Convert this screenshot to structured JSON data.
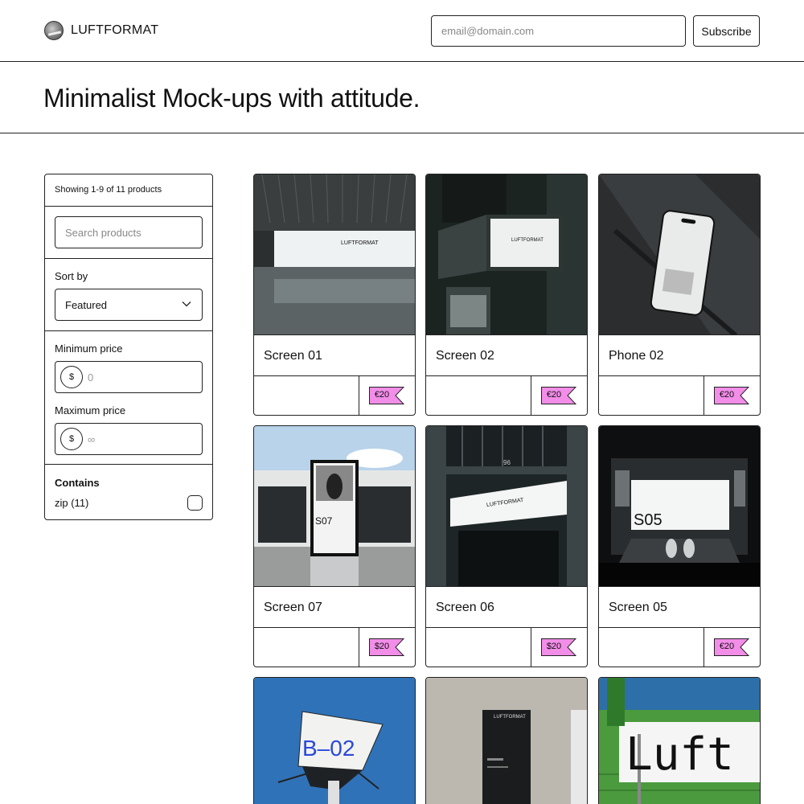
{
  "brand": {
    "name": "LUFTFORMAT"
  },
  "newsletter": {
    "email_placeholder": "email@domain.com",
    "subscribe_label": "Subscribe"
  },
  "hero": {
    "title": "Minimalist Mock-ups with attitude."
  },
  "sidebar": {
    "count_text": "Showing 1-9 of 11 products",
    "search_placeholder": "Search products",
    "sort_label": "Sort by",
    "sort_value": "Featured",
    "min_price_label": "Minimum price",
    "min_price_value": "0",
    "max_price_label": "Maximum price",
    "max_price_value": "∞",
    "currency_symbol": "$",
    "contains_title": "Contains",
    "contains_items": [
      {
        "label": "zip (11)",
        "checked": false
      }
    ]
  },
  "products": [
    {
      "name": "Screen 01",
      "price": "€20",
      "image_text": "LUFTFORMAT"
    },
    {
      "name": "Screen 02",
      "price": "€20",
      "image_text": "LUFTFORMAT"
    },
    {
      "name": "Phone 02",
      "price": "€20",
      "image_text": ""
    },
    {
      "name": "Screen 07",
      "price": "$20",
      "image_text": "S07"
    },
    {
      "name": "Screen 06",
      "price": "$20",
      "image_text": "LUFTFORMAT",
      "image_number": "96"
    },
    {
      "name": "Screen 05",
      "price": "€20",
      "image_text": "S05"
    },
    {
      "name": "",
      "price": "",
      "image_text": "B–02"
    },
    {
      "name": "",
      "price": "",
      "image_text": "LUFTFORMAT"
    },
    {
      "name": "",
      "price": "",
      "image_text": "Luft"
    }
  ],
  "colors": {
    "price_tag": "#f28de8",
    "border": "#222222"
  }
}
